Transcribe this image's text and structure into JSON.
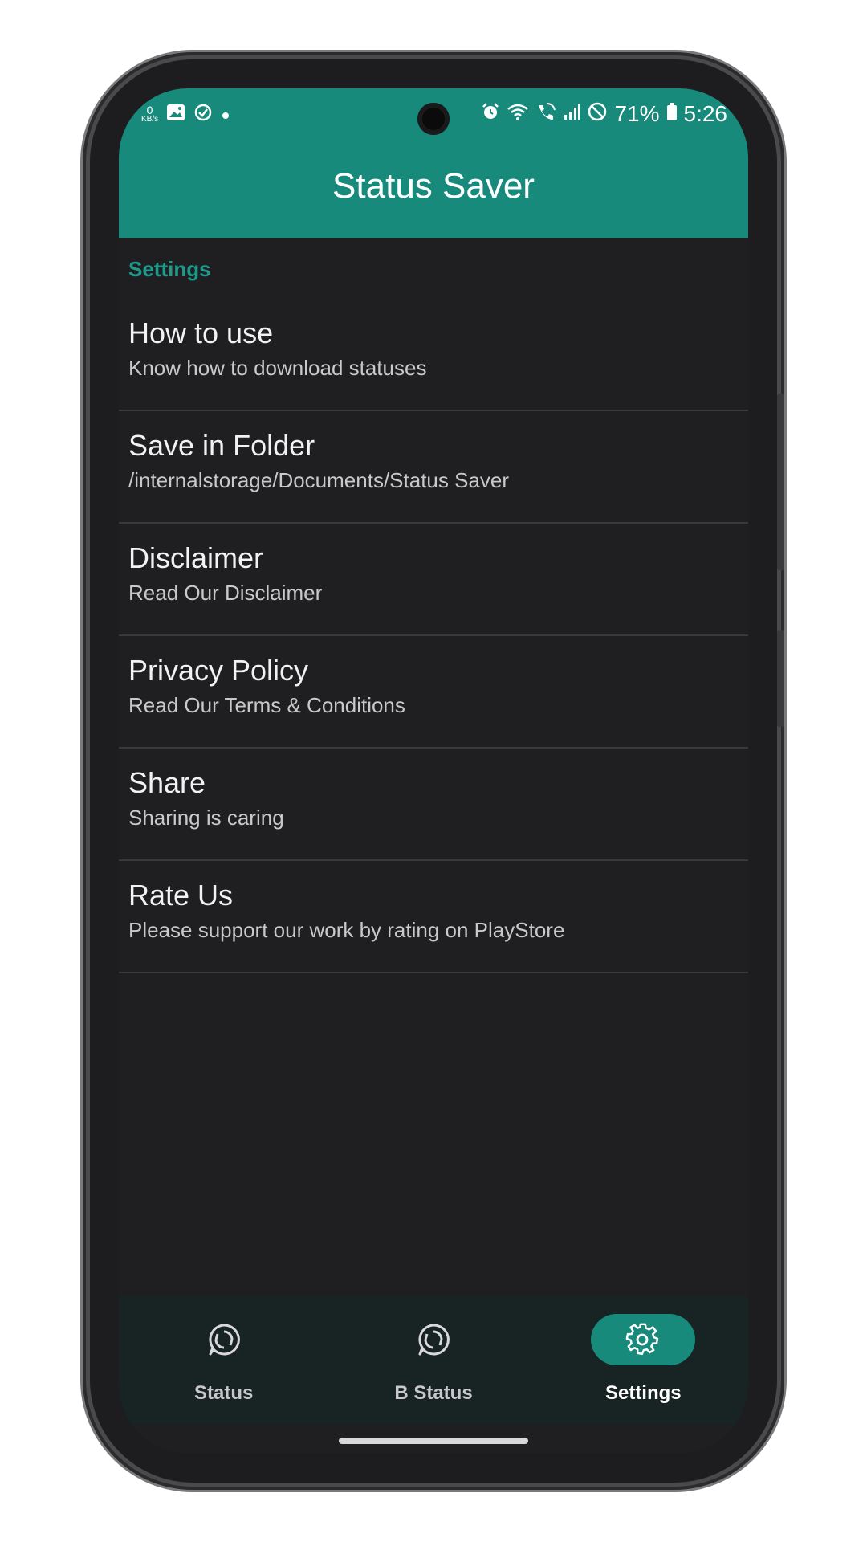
{
  "statusbar": {
    "left_icons": [
      "data-speed-icon",
      "gallery-icon",
      "check-circle-icon",
      "dot-icon"
    ],
    "net_speed_value": "0",
    "net_speed_unit": "KB/s",
    "right_icons": [
      "alarm-icon",
      "wifi-icon",
      "wifi-call-icon",
      "signal-icon",
      "do-not-disturb-icon",
      "battery-icon"
    ],
    "battery": "71%",
    "time": "5:26"
  },
  "appbar": {
    "title": "Status Saver",
    "color": "#178a7c"
  },
  "settings": {
    "section_label": "Settings",
    "items": [
      {
        "title": "How to use",
        "subtitle": "Know how to download statuses"
      },
      {
        "title": "Save in Folder",
        "subtitle": "/internalstorage/Documents/Status Saver"
      },
      {
        "title": "Disclaimer",
        "subtitle": "Read Our Disclaimer"
      },
      {
        "title": "Privacy Policy",
        "subtitle": "Read Our Terms & Conditions"
      },
      {
        "title": "Share",
        "subtitle": "Sharing is caring"
      },
      {
        "title": "Rate Us",
        "subtitle": "Please support our work by rating on PlayStore"
      }
    ]
  },
  "bottom_nav": {
    "items": [
      {
        "label": "Status",
        "icon": "status-icon",
        "active": false
      },
      {
        "label": "B Status",
        "icon": "business-status-icon",
        "active": false
      },
      {
        "label": "Settings",
        "icon": "gear-icon",
        "active": true
      }
    ]
  }
}
